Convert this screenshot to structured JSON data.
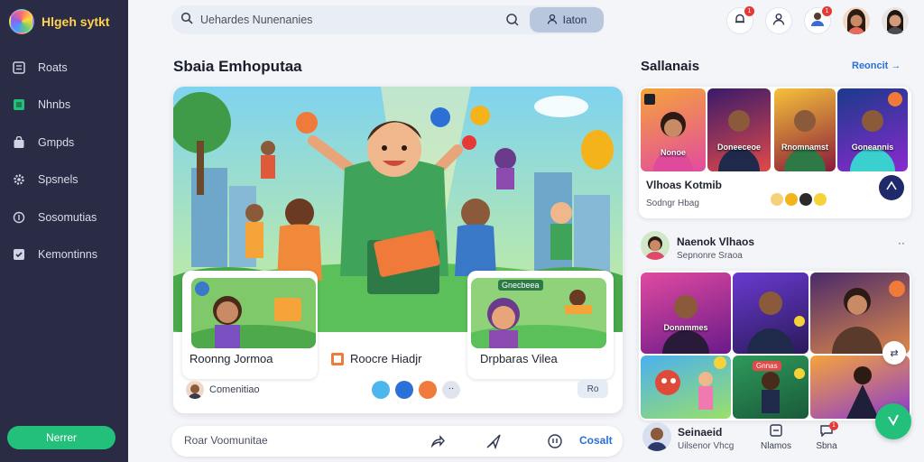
{
  "brand": {
    "name": "Hlgeh sytkt"
  },
  "sidebar": {
    "items": [
      {
        "label": "Roats",
        "icon": "grid-icon"
      },
      {
        "label": "Nhnbs",
        "icon": "square-icon"
      },
      {
        "label": "Gmpds",
        "icon": "bag-icon"
      },
      {
        "label": "Spsnels",
        "icon": "gear-icon"
      },
      {
        "label": "Sosomutias",
        "icon": "circle-info-icon"
      },
      {
        "label": "Kemontinns",
        "icon": "checkbox-icon"
      }
    ],
    "button_label": "Nerrer"
  },
  "search": {
    "placeholder": "Uehardes Nunenanies",
    "action_label": "Iaton"
  },
  "topbar": {
    "notification_count": "1",
    "message_count": "1"
  },
  "main": {
    "title": "Sbaia Emhoputaa",
    "cards": [
      {
        "label": "Roonng Jormoa"
      },
      {
        "label": "Roocre Hiadjr"
      },
      {
        "label": "Drpbaras Vilea"
      }
    ],
    "overlay_label": "Gnecbeea",
    "footer_text": "Comenitiao",
    "count_chip": "Ro"
  },
  "composer": {
    "placeholder": "Roar Voomunitae",
    "send_label": "Cosalt"
  },
  "right": {
    "title": "Sallanais",
    "see_all": "Reoncit",
    "top_thumbs": [
      "Nonoe",
      "Doneeceoe",
      "Rnomnamst",
      "Goneannis"
    ],
    "video_title": "Vlhoas Kotmib",
    "video_meta": "Sodngr Hbag",
    "channel_title": "Naenok Vlhaos",
    "channel_meta": "Sepnonre Sraoa",
    "grid_thumbs": [
      "Donnmmes",
      "",
      "",
      "",
      "Gnnas",
      ""
    ],
    "bottom_title": "Seinaeid",
    "bottom_meta": "Uilsenor Vhcg",
    "tab_1": "Nlamos",
    "tab_2": "Sbna",
    "fab_count": "1"
  },
  "colors": {
    "sidebar": "#2a2c45",
    "accent_green": "#22c07a",
    "accent_blue": "#2c6fd6",
    "brand_yellow": "#ffd34d"
  }
}
